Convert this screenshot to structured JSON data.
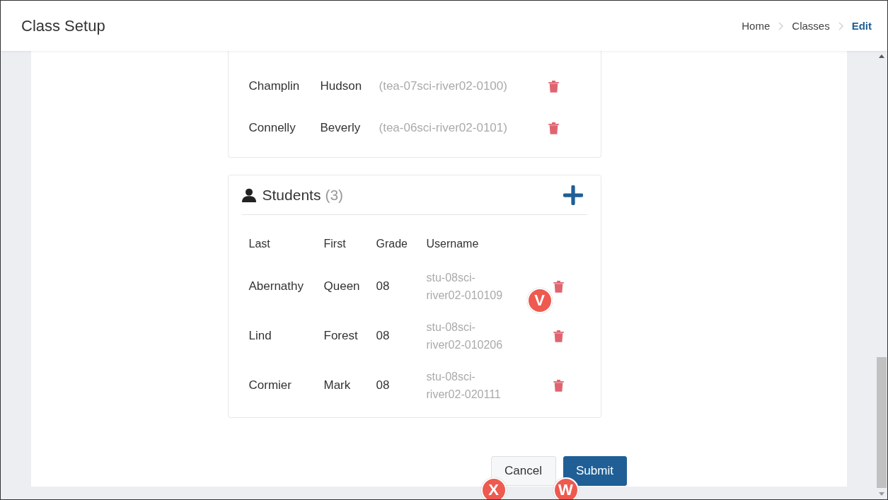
{
  "header": {
    "title": "Class Setup",
    "breadcrumbs": [
      {
        "label": "Home",
        "selected": false
      },
      {
        "label": "Classes",
        "selected": false
      },
      {
        "label": "Edit",
        "selected": true
      }
    ]
  },
  "teachers": [
    {
      "last": "Champlin",
      "first": "Hudson",
      "username": "(tea-07sci-river02-0100)"
    },
    {
      "last": "Connelly",
      "first": "Beverly",
      "username": "(tea-06sci-river02-0101)"
    }
  ],
  "students": {
    "title": "Students",
    "count": "(3)",
    "columns": [
      "Last",
      "First",
      "Grade",
      "Username"
    ],
    "rows": [
      {
        "last": "Abernathy",
        "first": "Queen",
        "grade": "08",
        "username": "stu-08sci-river02-010109",
        "callout": "V"
      },
      {
        "last": "Lind",
        "first": "Forest",
        "grade": "08",
        "username": "stu-08sci-river02-010206"
      },
      {
        "last": "Cormier",
        "first": "Mark",
        "grade": "08",
        "username": "stu-08sci-river02-020111"
      }
    ]
  },
  "buttons": [
    {
      "label": "Cancel",
      "kind": "secondary",
      "callout": "X"
    },
    {
      "label": "Submit",
      "kind": "primary",
      "callout": "W"
    }
  ]
}
